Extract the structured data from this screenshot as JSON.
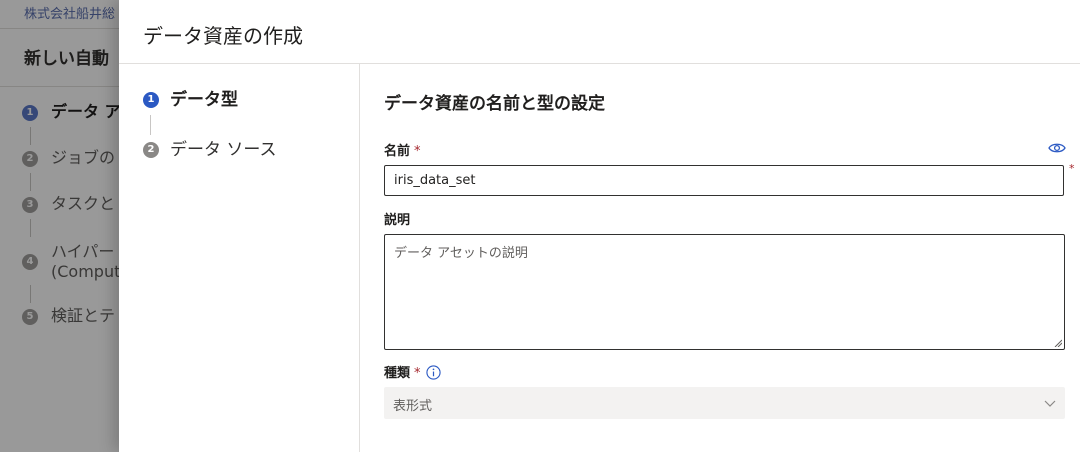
{
  "background": {
    "org_name": "株式会社船井総",
    "page_title": "新しい自動",
    "steps": [
      {
        "number": "1",
        "label": "データ ア"
      },
      {
        "number": "2",
        "label": "ジョブの"
      },
      {
        "number": "3",
        "label": "タスクと"
      },
      {
        "number": "4",
        "label": "ハイパー",
        "sublabel": "(Compute"
      },
      {
        "number": "5",
        "label": "検証とテ"
      }
    ]
  },
  "panel": {
    "title": "データ資産の作成",
    "wizard_steps": [
      {
        "number": "1",
        "label": "データ型"
      },
      {
        "number": "2",
        "label": "データ ソース"
      }
    ],
    "section_title": "データ資産の名前と型の設定",
    "name_field": {
      "label": "名前",
      "required_mark": "*",
      "value": "iris_data_set"
    },
    "description_field": {
      "label": "説明",
      "placeholder": "データ アセットの説明"
    },
    "type_field": {
      "label": "種類",
      "required_mark": "*",
      "value": "表形式"
    }
  },
  "icons": {
    "visibility": "eye-icon",
    "info": "info-icon",
    "dropdown": "chevron-down-icon"
  },
  "colors": {
    "accent": "#2b59c3",
    "required": "#a4262c"
  }
}
